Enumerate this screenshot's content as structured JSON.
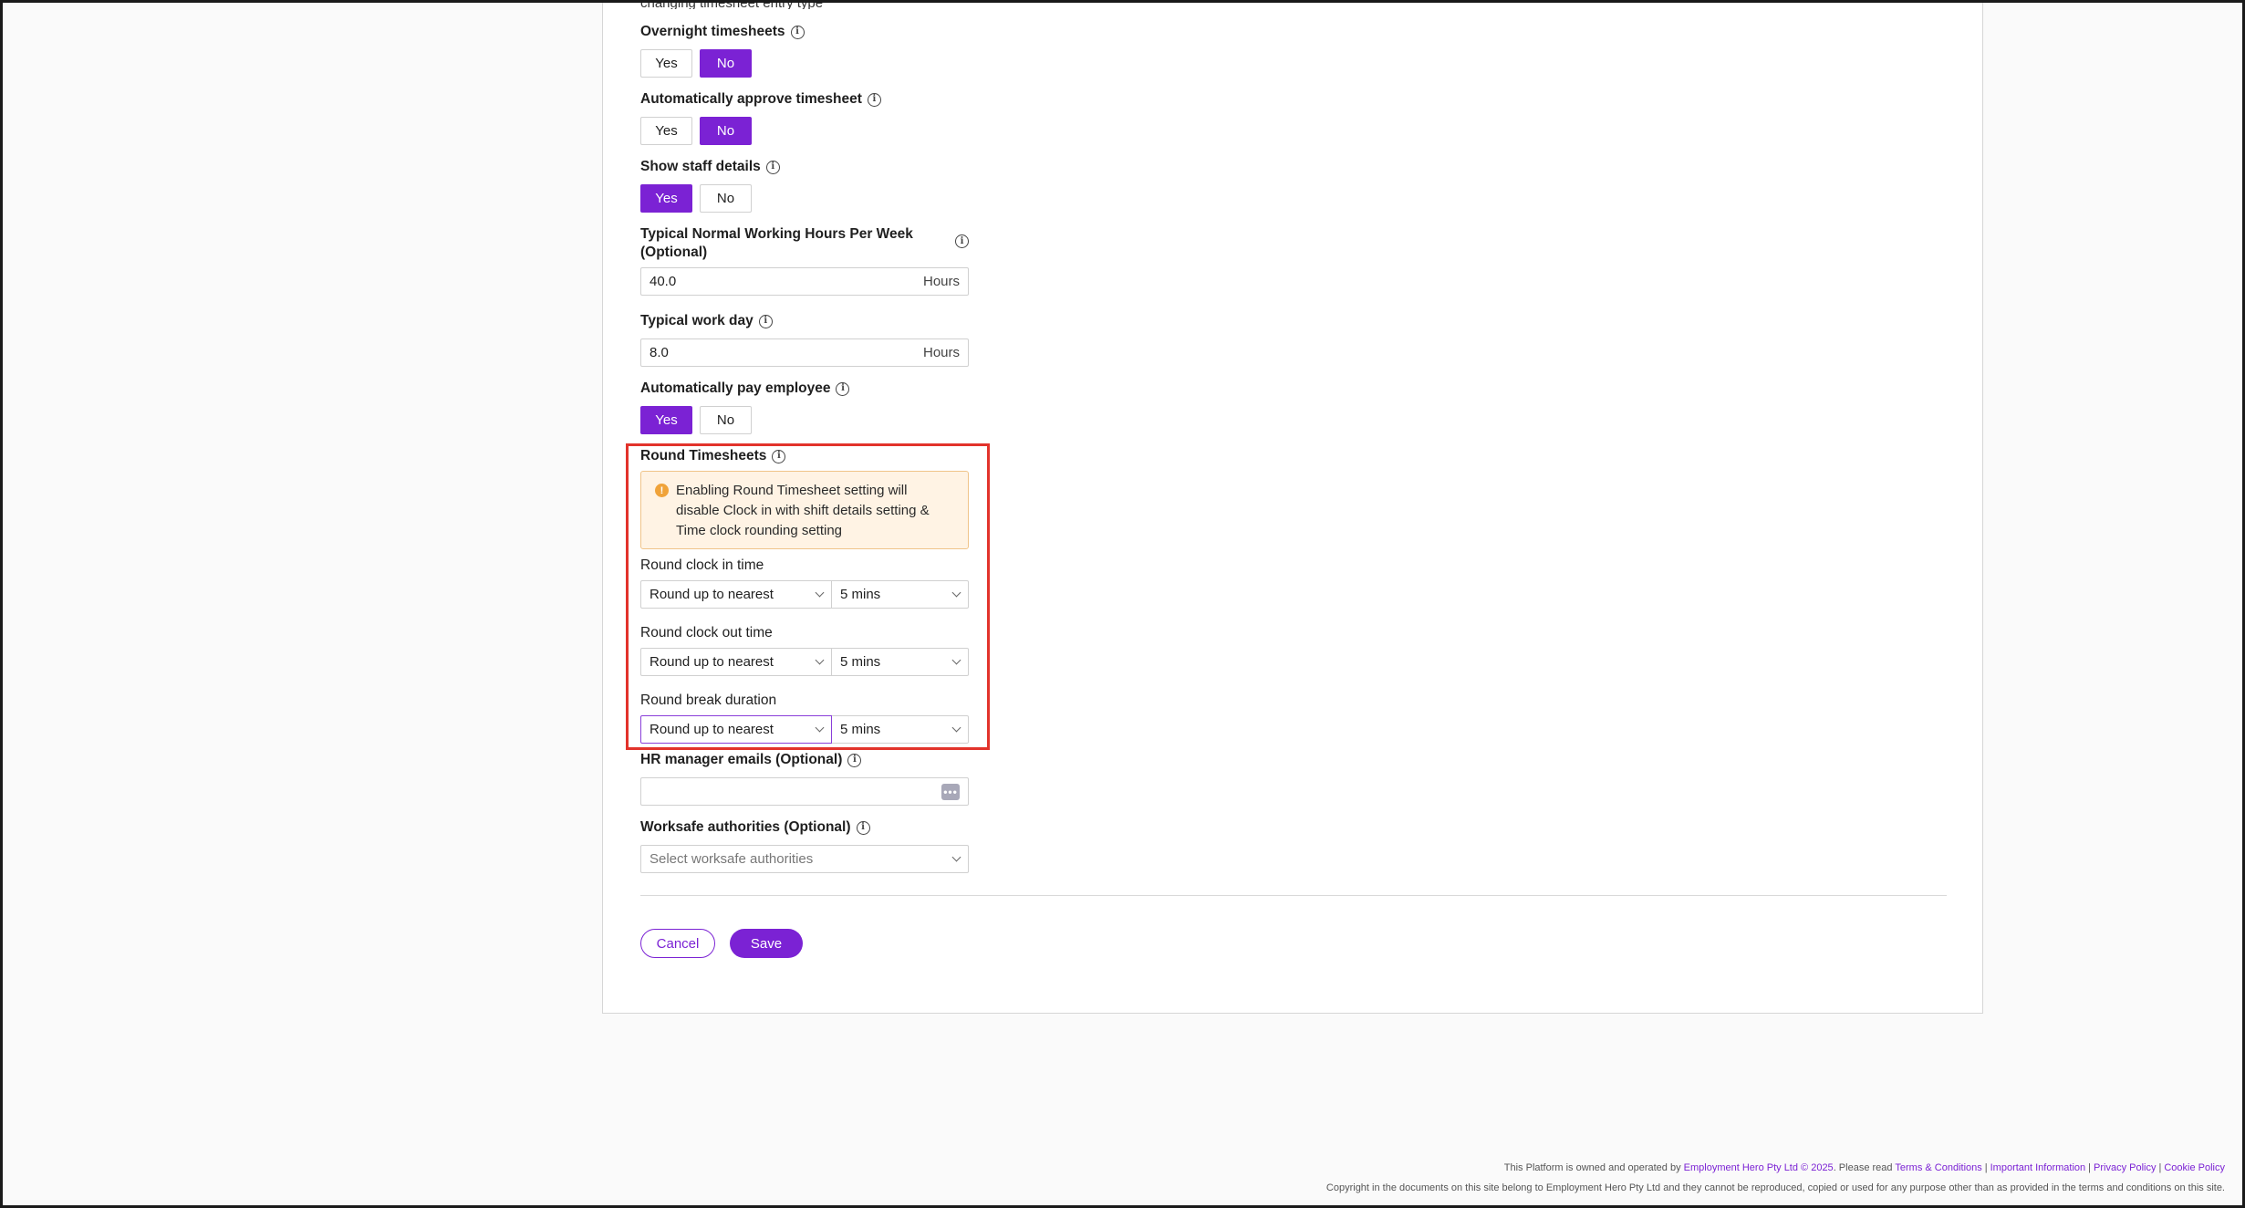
{
  "truncated_text": "changing timesheet entry type",
  "overnight_timesheets": {
    "label": "Overnight timesheets",
    "yes": "Yes",
    "no": "No",
    "selected": "No"
  },
  "auto_approve": {
    "label": "Automatically approve timesheet",
    "yes": "Yes",
    "no": "No",
    "selected": "No"
  },
  "show_staff": {
    "label": "Show staff details",
    "yes": "Yes",
    "no": "No",
    "selected": "Yes"
  },
  "normal_hours": {
    "label": "Typical Normal Working Hours Per Week (Optional)",
    "value": "40.0",
    "suffix": "Hours"
  },
  "work_day": {
    "label": "Typical work day",
    "value": "8.0",
    "suffix": "Hours"
  },
  "auto_pay": {
    "label": "Automatically pay employee",
    "yes": "Yes",
    "no": "No",
    "selected": "Yes"
  },
  "round_timesheets": {
    "label": "Round Timesheets",
    "warning": "Enabling Round Timesheet setting will disable Clock in with shift details setting & Time clock rounding setting",
    "clock_in": {
      "label": "Round clock in time",
      "mode": "Round up to nearest",
      "interval": "5 mins"
    },
    "clock_out": {
      "label": "Round clock out time",
      "mode": "Round up to nearest",
      "interval": "5 mins"
    },
    "break_duration": {
      "label": "Round break duration",
      "mode": "Round up to nearest",
      "interval": "5 mins"
    }
  },
  "hr_emails": {
    "label": "HR manager emails (Optional)",
    "value": ""
  },
  "worksafe": {
    "label": "Worksafe authorities (Optional)",
    "placeholder": "Select worksafe authorities"
  },
  "actions": {
    "cancel": "Cancel",
    "save": "Save"
  },
  "footer": {
    "line1_prefix": "This Platform is owned and operated by",
    "company_link": "Employment Hero Pty Ltd © 2025",
    "please_read": ". Please read",
    "terms": "Terms & Conditions",
    "important": "Important Information",
    "privacy": "Privacy Policy",
    "cookie": "Cookie Policy",
    "line2": "Copyright in the documents on this site belong to Employment Hero Pty Ltd and they cannot be reproduced, copied or used for any purpose other than as provided in the terms and conditions on this site."
  },
  "colors": {
    "accent": "#7b22d4",
    "highlight": "#e2332b",
    "warning_bg": "#fff3e4"
  }
}
